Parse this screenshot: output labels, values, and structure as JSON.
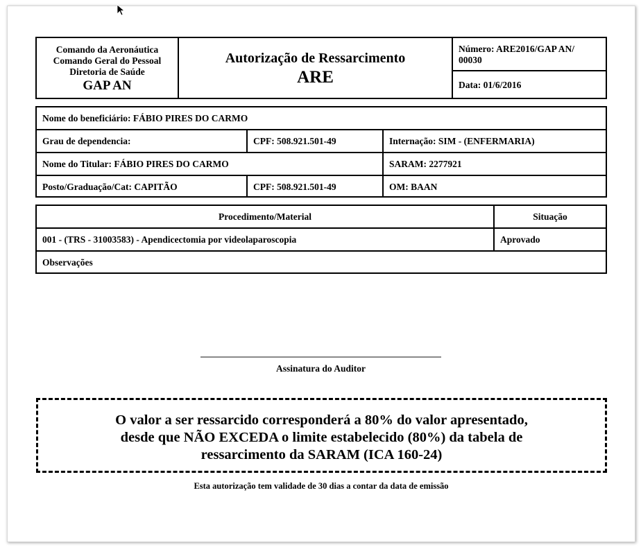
{
  "header": {
    "org_line1": "Comando da Aeronáutica",
    "org_line2": "Comando Geral do Pessoal",
    "org_line3": "Diretoria de Saúde",
    "org_unit": "GAP AN",
    "title": "Autorização de Ressarcimento",
    "title_abbr": "ARE",
    "number_line1": "Número: ARE2016/GAP AN/",
    "number_line2": "00030",
    "date": "Data: 01/6/2016"
  },
  "beneficiary": {
    "name": "Nome do beneficiário: FÁBIO PIRES DO CARMO",
    "dependency": "Grau de dependencia:",
    "cpf": "CPF: 508.921.501-49",
    "internacao": "Internação: SIM - (ENFERMARIA)",
    "titular": "Nome do Titular: FÁBIO PIRES DO CARMO",
    "saram": "SARAM: 2277921",
    "posto": "Posto/Graduação/Cat: CAPITÃO",
    "titular_cpf": "CPF: 508.921.501-49",
    "om": "OM: BAAN"
  },
  "procedures": {
    "col_procedure": "Procedimento/Material",
    "col_status": "Situação",
    "rows": [
      {
        "procedure": "001 - (TRS - 31003583) - Apendicectomia por videolaparoscopia",
        "status": "Aprovado"
      }
    ],
    "observations_label": "Observações"
  },
  "signature": {
    "label": "Assinatura do Auditor"
  },
  "notice": {
    "line1": "O valor a ser ressarcido corresponderá a 80% do valor apresentado,",
    "line2": "desde que NÃO EXCEDA o limite estabelecido (80%) da tabela de",
    "line3": "ressarcimento da SARAM (ICA 160-24)"
  },
  "validity": "Esta autorização tem validade de 30 dias a contar da data de emissão"
}
